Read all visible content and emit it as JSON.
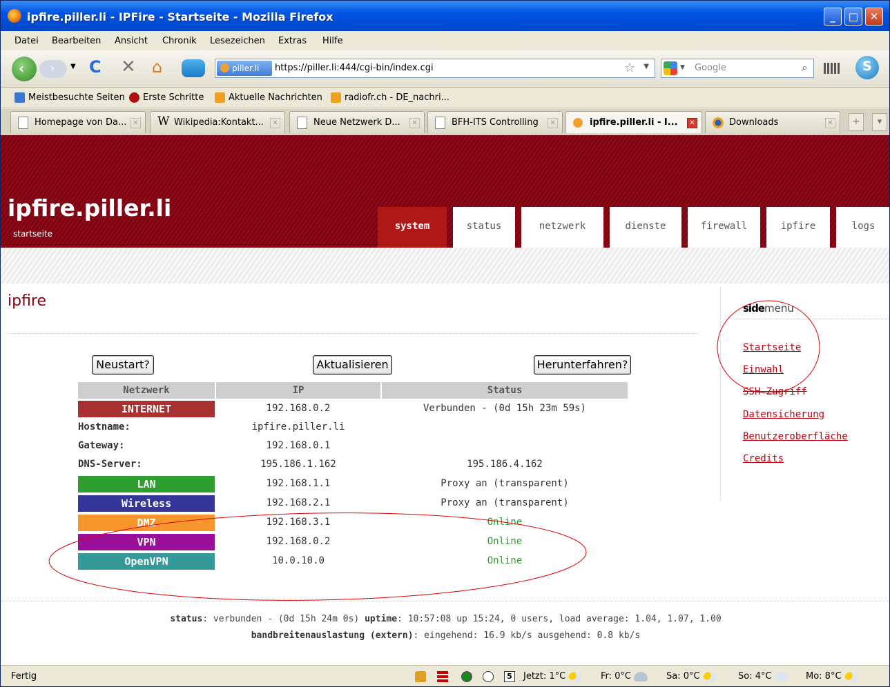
{
  "window": {
    "title": "ipfire.piller.li - IPFire - Startseite - Mozilla Firefox"
  },
  "menu": [
    "Datei",
    "Bearbeiten",
    "Ansicht",
    "Chronik",
    "Lesezeichen",
    "Extras",
    "Hilfe"
  ],
  "urlbar": {
    "site": "piller.li",
    "url": "https://piller.li:444/cgi-bin/index.cgi"
  },
  "search": {
    "placeholder": "Google"
  },
  "bookmarks": [
    "Meistbesuchte Seiten",
    "Erste Schritte",
    "Aktuelle Nachrichten",
    "radiofr.ch - DE_nachri..."
  ],
  "tabs": [
    "Homepage von Da...",
    "Wikipedia:Kontakt...",
    "Neue Netzwerk D...",
    "BFH-ITS Controlling",
    "ipfire.piller.li - I...",
    "Downloads"
  ],
  "site": {
    "title": "ipfire.piller.li",
    "subtitle": "startseite"
  },
  "nav": [
    "system",
    "status",
    "netzwerk",
    "dienste",
    "firewall",
    "ipfire",
    "logs"
  ],
  "content_title": "ipfire",
  "buttons": {
    "restart": "Neustart?",
    "refresh": "Aktualisieren",
    "shutdown": "Herunterfahren?"
  },
  "table": {
    "headers": [
      "Netzwerk",
      "IP",
      "Status"
    ],
    "internet": {
      "label": "INTERNET",
      "ip": "192.168.0.2",
      "status": "Verbunden - (0d 15h 23m 59s)"
    },
    "hostname": {
      "label": "Hostname:",
      "value": "ipfire.piller.li"
    },
    "gateway": {
      "label": "Gateway:",
      "value": "192.168.0.1"
    },
    "dns": {
      "label": "DNS-Server:",
      "value1": "195.186.1.162",
      "value2": "195.186.4.162"
    },
    "lan": {
      "label": "LAN",
      "ip": "192.168.1.1",
      "status": "Proxy an (transparent)"
    },
    "wireless": {
      "label": "Wireless",
      "ip": "192.168.2.1",
      "status": "Proxy an (transparent)"
    },
    "dmz": {
      "label": "DMZ",
      "ip": "192.168.3.1",
      "status": "Online"
    },
    "vpn": {
      "label": "VPN",
      "ip": "192.168.0.2",
      "status": "Online"
    },
    "openvpn": {
      "label": "OpenVPN",
      "ip": "10.0.10.0",
      "status": "Online"
    }
  },
  "sidemenu": {
    "title_bold": "side",
    "title_rest": "menu",
    "items": [
      "Startseite",
      "Einwahl",
      "SSH-Zugriff",
      "Datensicherung",
      "Benutzeroberfläche",
      "Credits"
    ]
  },
  "footer": {
    "status_label": "status",
    "status_value": ": verbunden - (0d 15h 24m 0s) ",
    "uptime_label": "uptime",
    "uptime_value": ": 10:57:08 up 15:24, 0 users, load average: 1.04, 1.07, 1.00",
    "bw_label": "bandbreitenauslastung (extern)",
    "bw_value": ": eingehend: 16.9 kb/s ausgehend: 0.8 kb/s"
  },
  "statusbar": {
    "text": "Fertig",
    "calendar_day": "5",
    "weather": [
      "Jetzt: 1°C",
      "Fr: 0°C",
      "Sa: 0°C",
      "So: 4°C",
      "Mo: 8°C"
    ]
  },
  "colors": {
    "brand": "#8a0a18",
    "internet": "#a83232",
    "lan": "#2e9e2e",
    "wireless": "#36369a",
    "dmz": "#f7962d",
    "vpn": "#9a0f9a",
    "openvpn": "#339999",
    "annotation": "#e00000"
  }
}
